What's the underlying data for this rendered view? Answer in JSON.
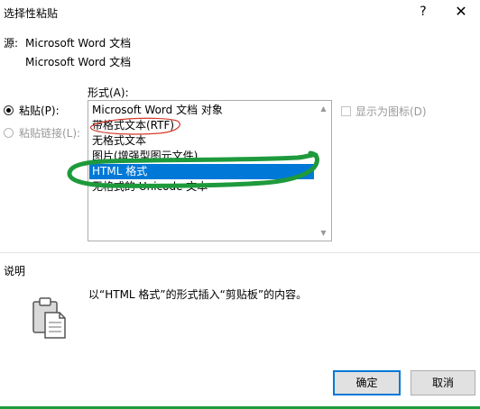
{
  "dialog": {
    "title": "选择性粘贴",
    "help_symbol": "?",
    "close_symbol": "✕"
  },
  "source": {
    "label": "源:",
    "line1": "Microsoft Word 文档",
    "line2": "Microsoft Word 文档"
  },
  "format_label": "形式(A):",
  "options": {
    "paste": {
      "label": "粘贴(P):",
      "checked": true
    },
    "paste_link": {
      "label": "粘贴链接(L):",
      "checked": false,
      "disabled": true
    }
  },
  "formats": [
    {
      "label": "Microsoft Word 文档 对象",
      "selected": false
    },
    {
      "label": "带格式文本(RTF)",
      "selected": false
    },
    {
      "label": "无格式文本",
      "selected": false
    },
    {
      "label": "图片(增强型图元文件)",
      "selected": false
    },
    {
      "label": "HTML 格式",
      "selected": true
    },
    {
      "label": "无格式的 Unicode 文本",
      "selected": false
    }
  ],
  "display_as_icon": {
    "label": "显示为图标(D)",
    "checked": false,
    "disabled": true
  },
  "explanation": {
    "title": "说明",
    "text": "以“HTML 格式”的形式插入“剪贴板”的内容。"
  },
  "buttons": {
    "ok": "确定",
    "cancel": "取消"
  },
  "colors": {
    "selection": "#0078d7",
    "annotation_red": "#d43a2c",
    "annotation_green": "#1e9a3c"
  }
}
